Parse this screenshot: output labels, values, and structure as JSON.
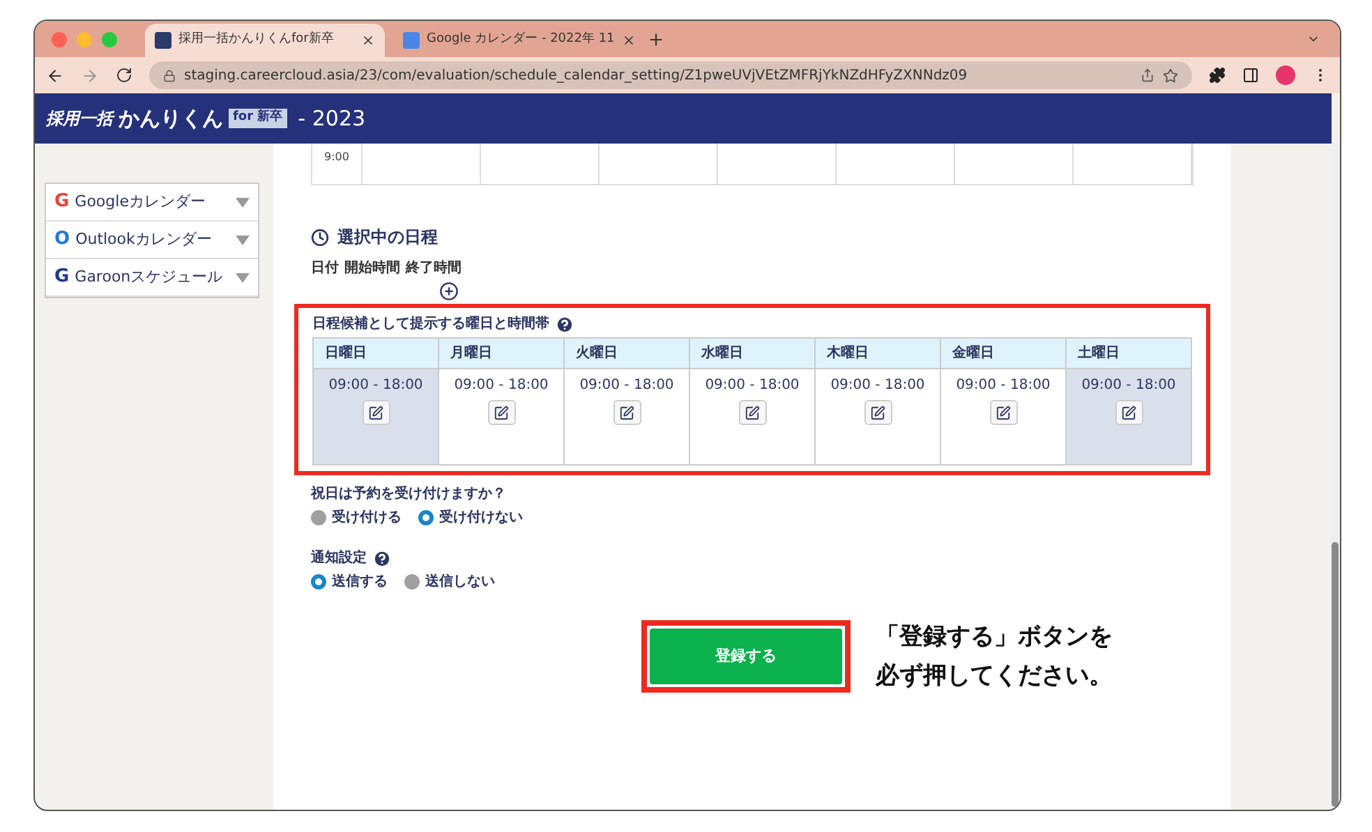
{
  "browser": {
    "tabs": [
      {
        "title": "採用一括かんりくんfor新卒",
        "selected": true
      },
      {
        "title": "Google カレンダー - 2022年 11",
        "selected": false
      }
    ],
    "url": "staging.careercloud.asia/23/com/evaluation/schedule_calendar_setting/Z1pweUVjVEtZMFRjYkNZdHFyZXNNdz09"
  },
  "header": {
    "logo_main": "採用一括",
    "logo_kana": "かんりくん",
    "logo_badge": "for 新卒",
    "year": "- 2023"
  },
  "sidebar": {
    "items": [
      {
        "mark": "G",
        "label": "Googleカレンダー",
        "color": "#e8453c"
      },
      {
        "mark": "O",
        "label": "Outlookカレンダー",
        "color": "#1f7ad8"
      },
      {
        "mark": "G",
        "label": "Garoonスケジュール",
        "color": "#1f3a8a"
      }
    ]
  },
  "calendar_remnant": {
    "time": "9:00"
  },
  "selected_schedule": {
    "title": "選択中の日程",
    "columns": [
      "日付",
      "開始時間",
      "終了時間"
    ]
  },
  "weekly": {
    "title": "日程候補として提示する曜日と時間帯",
    "days": [
      {
        "name": "日曜日",
        "hours": "09:00 - 18:00",
        "shaded": true
      },
      {
        "name": "月曜日",
        "hours": "09:00 - 18:00",
        "shaded": false
      },
      {
        "name": "火曜日",
        "hours": "09:00 - 18:00",
        "shaded": false
      },
      {
        "name": "水曜日",
        "hours": "09:00 - 18:00",
        "shaded": false
      },
      {
        "name": "木曜日",
        "hours": "09:00 - 18:00",
        "shaded": false
      },
      {
        "name": "金曜日",
        "hours": "09:00 - 18:00",
        "shaded": false
      },
      {
        "name": "土曜日",
        "hours": "09:00 - 18:00",
        "shaded": true
      }
    ]
  },
  "holidays": {
    "question": "祝日は予約を受け付けますか？",
    "options": [
      {
        "label": "受け付ける",
        "selected": false
      },
      {
        "label": "受け付けない",
        "selected": true
      }
    ]
  },
  "notification": {
    "title": "通知設定",
    "options": [
      {
        "label": "送信する",
        "selected": true
      },
      {
        "label": "送信しない",
        "selected": false
      }
    ]
  },
  "submit": {
    "label": "登録する"
  },
  "annotation": {
    "lines": [
      "「登録する」ボタンを",
      "必ず押してください。"
    ]
  }
}
